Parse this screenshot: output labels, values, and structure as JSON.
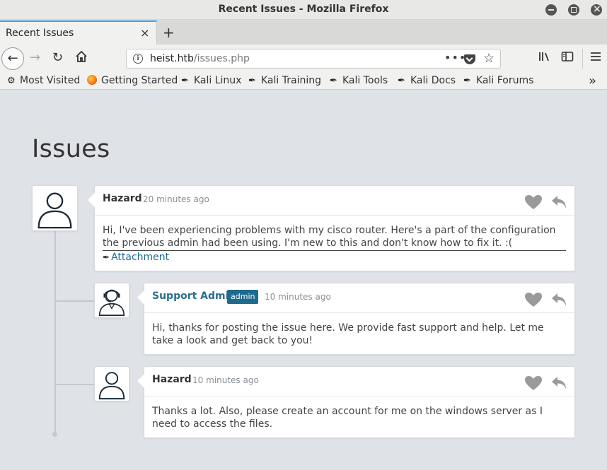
{
  "window": {
    "title": "Recent Issues - Mozilla Firefox"
  },
  "tabs": [
    {
      "label": "Recent Issues",
      "close": "×"
    }
  ],
  "toolbar": {
    "new_tab": "+",
    "url_host": "heist.htb",
    "url_path": "/issues.php",
    "page_actions": "•••"
  },
  "bookmarks": [
    {
      "label": "Most Visited",
      "icon": "gear-icon"
    },
    {
      "label": "Getting Started",
      "icon": "firefox-icon"
    },
    {
      "label": "Kali Linux",
      "icon": "kali-dragon-icon"
    },
    {
      "label": "Kali Training",
      "icon": "kali-dragon-icon"
    },
    {
      "label": "Kali Tools",
      "icon": "kali-dragon-icon"
    },
    {
      "label": "Kali Docs",
      "icon": "kali-dragon-icon"
    },
    {
      "label": "Kali Forums",
      "icon": "kali-dragon-icon"
    }
  ],
  "page": {
    "title": "Issues"
  },
  "comments": [
    {
      "author": "Hazard",
      "time": "20 minutes ago",
      "body": "Hi, I've been experiencing problems with my cisco router. Here's a part of the configuration the previous admin had been using. I'm new to this and don't know how to fix it. :(",
      "attachment": "Attachment"
    },
    {
      "author": "Support Admin",
      "badge": "admin",
      "time": "10 minutes ago",
      "body": "Hi, thanks for posting the issue here. We provide fast support and help. Let me take a look and get back to you!"
    },
    {
      "author": "Hazard",
      "time": "10 minutes ago",
      "body": "Thanks a lot. Also, please create an account for me on the windows server as I need to access the files."
    }
  ],
  "colors": {
    "accent": "#1f6b8f",
    "tab_highlight": "#3aa0e8",
    "page_bg": "#dfe2e6"
  }
}
